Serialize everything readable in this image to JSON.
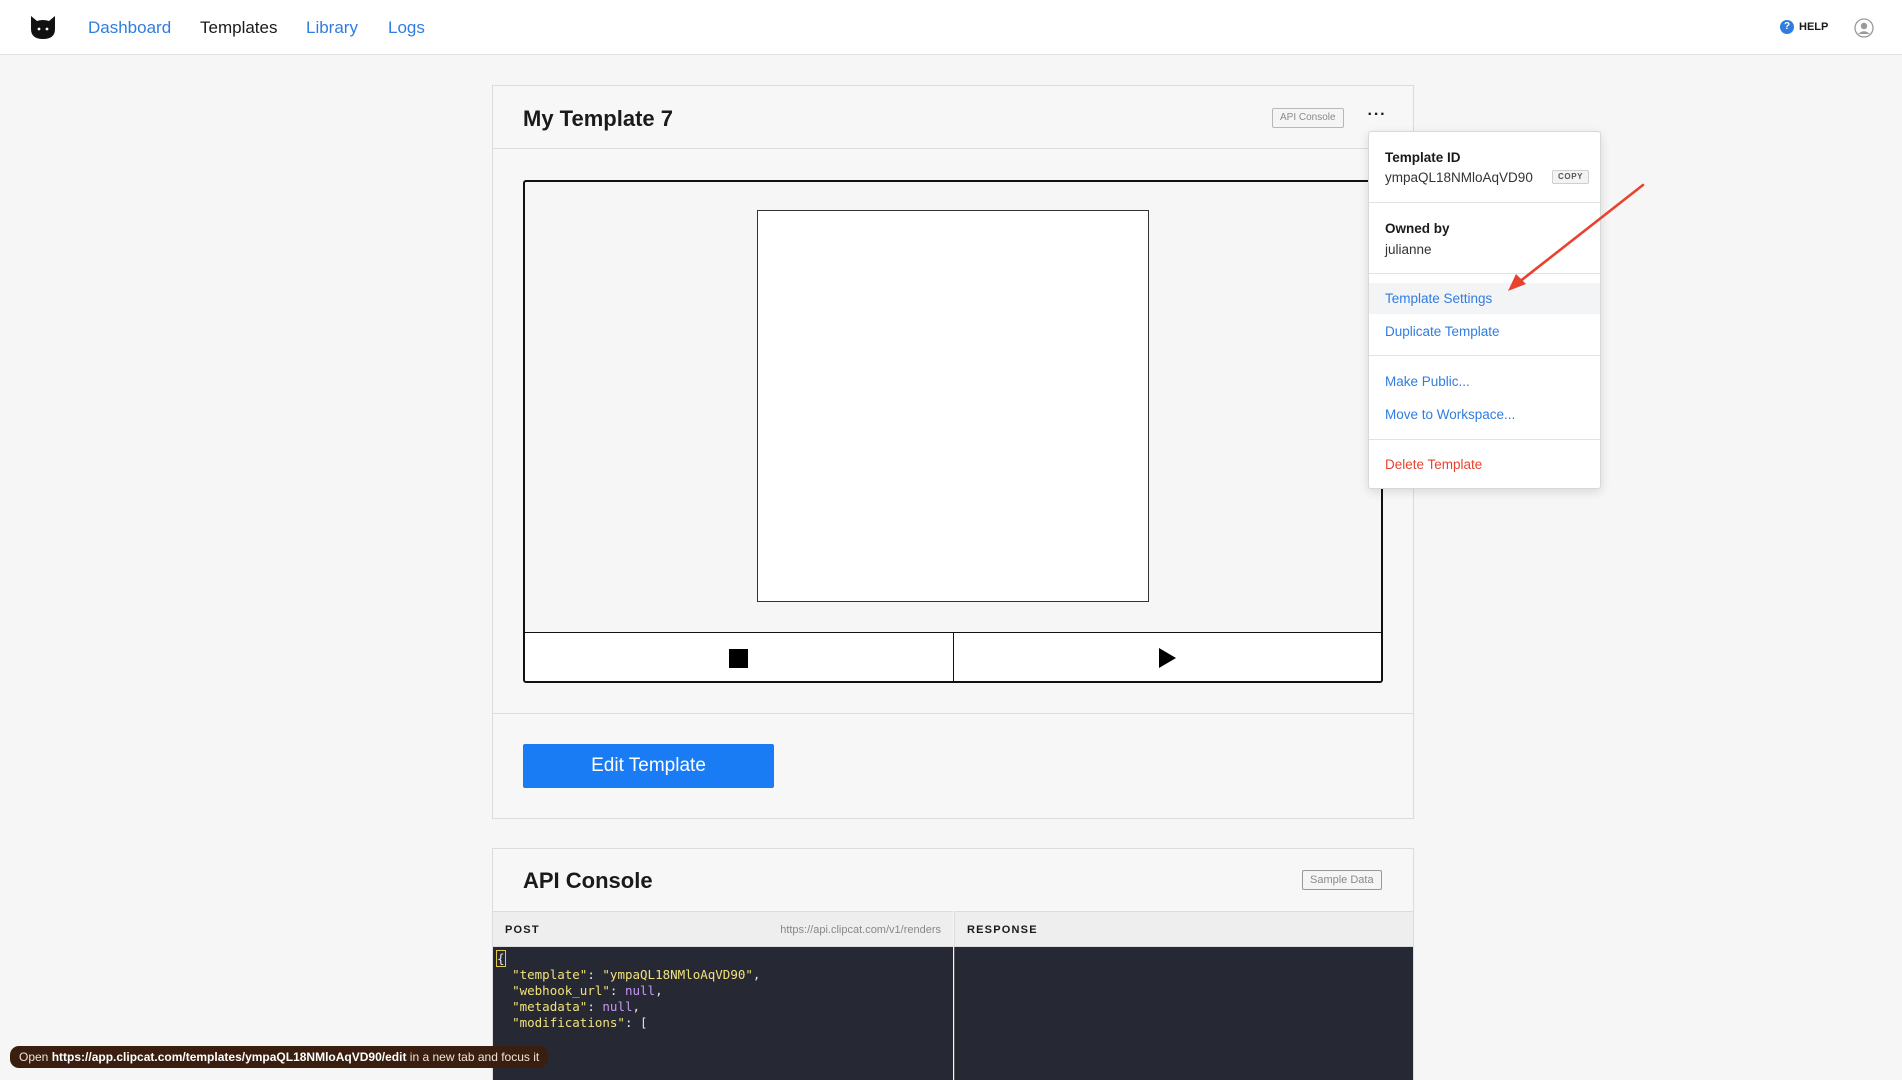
{
  "nav": {
    "links": [
      "Dashboard",
      "Templates",
      "Library",
      "Logs"
    ],
    "active": "Templates",
    "help_label": "HELP",
    "help_glyph": "?",
    "logo_icon": "cat-logo-icon",
    "avatar_icon": "user-avatar-icon"
  },
  "template": {
    "title": "My Template 7",
    "api_console_badge": "API Console",
    "more_glyph": "···",
    "edit_button": "Edit Template",
    "controls": [
      "stop-icon",
      "play-icon"
    ]
  },
  "menu": {
    "id_label": "Template ID",
    "id_value": "ympaQL18NMloAqVD90",
    "copy_label": "COPY",
    "owner_label": "Owned by",
    "owner_value": "julianne",
    "items": [
      "Template Settings",
      "Duplicate Template",
      "Make Public...",
      "Move to Workspace...",
      "Delete Template"
    ],
    "highlighted_item": "Template Settings"
  },
  "api_console": {
    "title": "API Console",
    "sample_badge": "Sample Data",
    "post_label": "POST",
    "post_url": "https://api.clipcat.com/v1/renders",
    "response_label": "RESPONSE",
    "code": {
      "open": "{",
      "template_key": "\"template\"",
      "template_val": "\"ympaQL18NMloAqVD90\"",
      "webhook_key": "\"webhook_url\"",
      "metadata_key": "\"metadata\"",
      "modifications_key": "\"modifications\"",
      "null_kw": "null"
    }
  },
  "status": {
    "prefix": "Open",
    "url": "https://app.clipcat.com/templates/ympaQL18NMloAqVD90/edit",
    "suffix": "in a new tab and focus it"
  },
  "colors": {
    "accent": "#1a7cf5",
    "link": "#2f7de1",
    "danger": "#e8432f",
    "annotation_arrow": "#e8432f",
    "code_bg": "#262833"
  }
}
